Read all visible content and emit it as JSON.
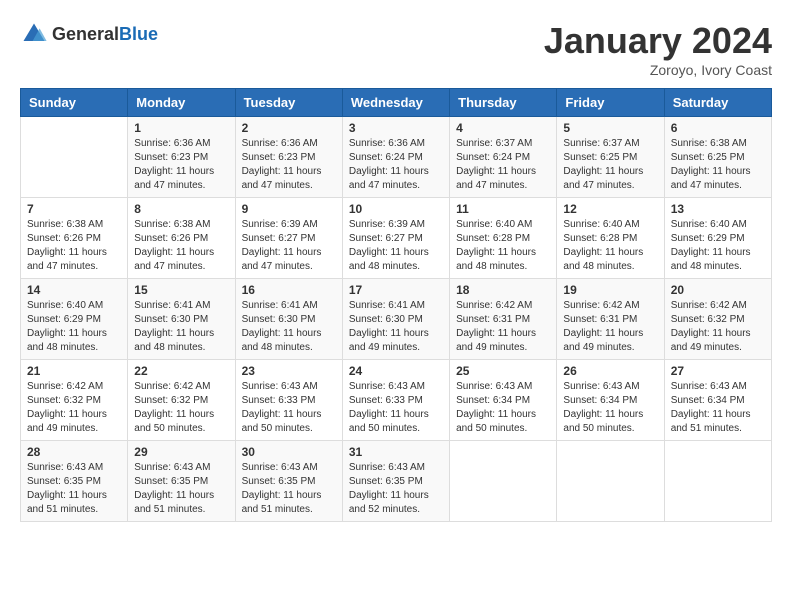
{
  "header": {
    "logo_general": "General",
    "logo_blue": "Blue",
    "month_year": "January 2024",
    "location": "Zoroyo, Ivory Coast"
  },
  "days_of_week": [
    "Sunday",
    "Monday",
    "Tuesday",
    "Wednesday",
    "Thursday",
    "Friday",
    "Saturday"
  ],
  "weeks": [
    [
      {
        "day": "",
        "sunrise": "",
        "sunset": "",
        "daylight": ""
      },
      {
        "day": "1",
        "sunrise": "Sunrise: 6:36 AM",
        "sunset": "Sunset: 6:23 PM",
        "daylight": "Daylight: 11 hours and 47 minutes."
      },
      {
        "day": "2",
        "sunrise": "Sunrise: 6:36 AM",
        "sunset": "Sunset: 6:23 PM",
        "daylight": "Daylight: 11 hours and 47 minutes."
      },
      {
        "day": "3",
        "sunrise": "Sunrise: 6:36 AM",
        "sunset": "Sunset: 6:24 PM",
        "daylight": "Daylight: 11 hours and 47 minutes."
      },
      {
        "day": "4",
        "sunrise": "Sunrise: 6:37 AM",
        "sunset": "Sunset: 6:24 PM",
        "daylight": "Daylight: 11 hours and 47 minutes."
      },
      {
        "day": "5",
        "sunrise": "Sunrise: 6:37 AM",
        "sunset": "Sunset: 6:25 PM",
        "daylight": "Daylight: 11 hours and 47 minutes."
      },
      {
        "day": "6",
        "sunrise": "Sunrise: 6:38 AM",
        "sunset": "Sunset: 6:25 PM",
        "daylight": "Daylight: 11 hours and 47 minutes."
      }
    ],
    [
      {
        "day": "7",
        "sunrise": "Sunrise: 6:38 AM",
        "sunset": "Sunset: 6:26 PM",
        "daylight": "Daylight: 11 hours and 47 minutes."
      },
      {
        "day": "8",
        "sunrise": "Sunrise: 6:38 AM",
        "sunset": "Sunset: 6:26 PM",
        "daylight": "Daylight: 11 hours and 47 minutes."
      },
      {
        "day": "9",
        "sunrise": "Sunrise: 6:39 AM",
        "sunset": "Sunset: 6:27 PM",
        "daylight": "Daylight: 11 hours and 47 minutes."
      },
      {
        "day": "10",
        "sunrise": "Sunrise: 6:39 AM",
        "sunset": "Sunset: 6:27 PM",
        "daylight": "Daylight: 11 hours and 48 minutes."
      },
      {
        "day": "11",
        "sunrise": "Sunrise: 6:40 AM",
        "sunset": "Sunset: 6:28 PM",
        "daylight": "Daylight: 11 hours and 48 minutes."
      },
      {
        "day": "12",
        "sunrise": "Sunrise: 6:40 AM",
        "sunset": "Sunset: 6:28 PM",
        "daylight": "Daylight: 11 hours and 48 minutes."
      },
      {
        "day": "13",
        "sunrise": "Sunrise: 6:40 AM",
        "sunset": "Sunset: 6:29 PM",
        "daylight": "Daylight: 11 hours and 48 minutes."
      }
    ],
    [
      {
        "day": "14",
        "sunrise": "Sunrise: 6:40 AM",
        "sunset": "Sunset: 6:29 PM",
        "daylight": "Daylight: 11 hours and 48 minutes."
      },
      {
        "day": "15",
        "sunrise": "Sunrise: 6:41 AM",
        "sunset": "Sunset: 6:30 PM",
        "daylight": "Daylight: 11 hours and 48 minutes."
      },
      {
        "day": "16",
        "sunrise": "Sunrise: 6:41 AM",
        "sunset": "Sunset: 6:30 PM",
        "daylight": "Daylight: 11 hours and 48 minutes."
      },
      {
        "day": "17",
        "sunrise": "Sunrise: 6:41 AM",
        "sunset": "Sunset: 6:30 PM",
        "daylight": "Daylight: 11 hours and 49 minutes."
      },
      {
        "day": "18",
        "sunrise": "Sunrise: 6:42 AM",
        "sunset": "Sunset: 6:31 PM",
        "daylight": "Daylight: 11 hours and 49 minutes."
      },
      {
        "day": "19",
        "sunrise": "Sunrise: 6:42 AM",
        "sunset": "Sunset: 6:31 PM",
        "daylight": "Daylight: 11 hours and 49 minutes."
      },
      {
        "day": "20",
        "sunrise": "Sunrise: 6:42 AM",
        "sunset": "Sunset: 6:32 PM",
        "daylight": "Daylight: 11 hours and 49 minutes."
      }
    ],
    [
      {
        "day": "21",
        "sunrise": "Sunrise: 6:42 AM",
        "sunset": "Sunset: 6:32 PM",
        "daylight": "Daylight: 11 hours and 49 minutes."
      },
      {
        "day": "22",
        "sunrise": "Sunrise: 6:42 AM",
        "sunset": "Sunset: 6:32 PM",
        "daylight": "Daylight: 11 hours and 50 minutes."
      },
      {
        "day": "23",
        "sunrise": "Sunrise: 6:43 AM",
        "sunset": "Sunset: 6:33 PM",
        "daylight": "Daylight: 11 hours and 50 minutes."
      },
      {
        "day": "24",
        "sunrise": "Sunrise: 6:43 AM",
        "sunset": "Sunset: 6:33 PM",
        "daylight": "Daylight: 11 hours and 50 minutes."
      },
      {
        "day": "25",
        "sunrise": "Sunrise: 6:43 AM",
        "sunset": "Sunset: 6:34 PM",
        "daylight": "Daylight: 11 hours and 50 minutes."
      },
      {
        "day": "26",
        "sunrise": "Sunrise: 6:43 AM",
        "sunset": "Sunset: 6:34 PM",
        "daylight": "Daylight: 11 hours and 50 minutes."
      },
      {
        "day": "27",
        "sunrise": "Sunrise: 6:43 AM",
        "sunset": "Sunset: 6:34 PM",
        "daylight": "Daylight: 11 hours and 51 minutes."
      }
    ],
    [
      {
        "day": "28",
        "sunrise": "Sunrise: 6:43 AM",
        "sunset": "Sunset: 6:35 PM",
        "daylight": "Daylight: 11 hours and 51 minutes."
      },
      {
        "day": "29",
        "sunrise": "Sunrise: 6:43 AM",
        "sunset": "Sunset: 6:35 PM",
        "daylight": "Daylight: 11 hours and 51 minutes."
      },
      {
        "day": "30",
        "sunrise": "Sunrise: 6:43 AM",
        "sunset": "Sunset: 6:35 PM",
        "daylight": "Daylight: 11 hours and 51 minutes."
      },
      {
        "day": "31",
        "sunrise": "Sunrise: 6:43 AM",
        "sunset": "Sunset: 6:35 PM",
        "daylight": "Daylight: 11 hours and 52 minutes."
      },
      {
        "day": "",
        "sunrise": "",
        "sunset": "",
        "daylight": ""
      },
      {
        "day": "",
        "sunrise": "",
        "sunset": "",
        "daylight": ""
      },
      {
        "day": "",
        "sunrise": "",
        "sunset": "",
        "daylight": ""
      }
    ]
  ]
}
